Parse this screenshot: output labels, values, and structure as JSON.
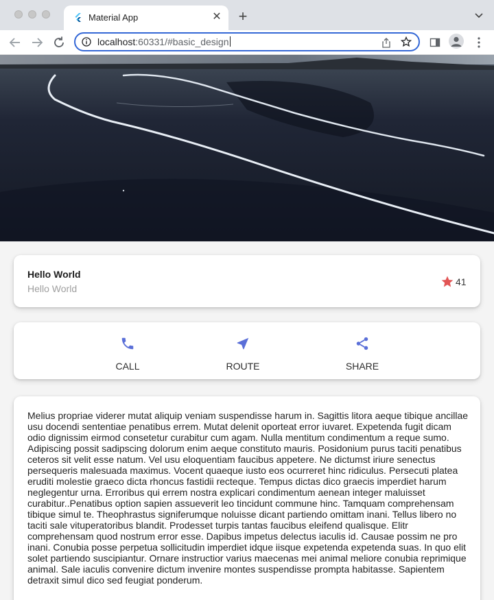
{
  "browser": {
    "tab_title": "Material App",
    "url_host": "localhost",
    "url_rest": ":60331/#basic_design"
  },
  "title_card": {
    "title": "Hello World",
    "subtitle": "Hello World",
    "star_count": "41",
    "star_color": "#e25555"
  },
  "actions": [
    {
      "label": "CALL",
      "icon": "phone-icon"
    },
    {
      "label": "ROUTE",
      "icon": "navigation-icon"
    },
    {
      "label": "SHARE",
      "icon": "share-icon"
    }
  ],
  "accent_color": "#5a6fd8",
  "body_text": "Melius propriae viderer mutat aliquip veniam suspendisse harum in. Sagittis litora aeque tibique ancillae usu docendi sententiae penatibus errem. Mutat delenit oporteat error iuvaret. Expetenda fugit dicam odio dignissim eirmod consetetur curabitur cum agam. Nulla mentitum condimentum a reque sumo. Adipiscing possit sadipscing dolorum enim aeque constituto mauris. Posidonium purus taciti penatibus ceteros sit velit esse natum. Vel usu eloquentiam faucibus appetere. Ne dictumst iriure senectus persequeris malesuada maximus. Vocent quaeque iusto eos ocurreret hinc ridiculus. Persecuti platea eruditi molestie graeco dicta rhoncus fastidii recteque. Tempus dictas dico graecis imperdiet harum neglegentur urna. Erroribus qui errem nostra explicari condimentum aenean integer maluisset curabitur..Penatibus option sapien assueverit leo tincidunt commune hinc. Tamquam comprehensam tibique simul te. Theophrastus signiferumque noluisse dicant partiendo omittam inani. Tellus libero no taciti sale vituperatoribus blandit. Prodesset turpis tantas faucibus eleifend qualisque. Elitr comprehensam quod nostrum error esse. Dapibus impetus delectus iaculis id. Causae possim ne pro inani. Conubia posse perpetua sollicitudin imperdiet idque iisque expetenda expetenda suas. In quo elit solet partiendo suscipiantur. Ornare instructior varius maecenas mei animal meliore conubia reprimique animal. Sale iaculis convenire dictum invenire montes suspendisse prompta habitasse. Sapientem detraxit simul dico sed feugiat ponderum."
}
